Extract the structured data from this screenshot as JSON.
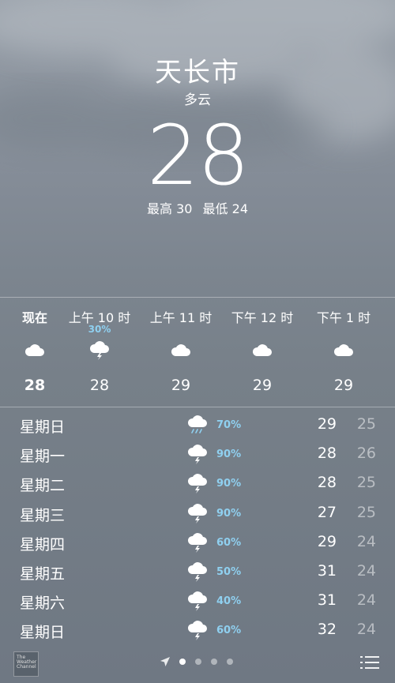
{
  "location": {
    "city": "天长市",
    "condition": "多云",
    "temperature": "28",
    "high": "最高 30",
    "low": "最低 24"
  },
  "hourly": [
    {
      "time": "现在",
      "pop": "",
      "icon": "cloud-icon",
      "temp": "28"
    },
    {
      "time": "上午 10 时",
      "pop": "30%",
      "icon": "thunderstorm-icon",
      "temp": "28"
    },
    {
      "time": "上午 11 时",
      "pop": "",
      "icon": "cloud-icon",
      "temp": "29"
    },
    {
      "time": "下午 12 时",
      "pop": "",
      "icon": "cloud-icon",
      "temp": "29"
    },
    {
      "time": "下午 1 时",
      "pop": "",
      "icon": "cloud-icon",
      "temp": "29"
    }
  ],
  "daily": [
    {
      "day": "星期日",
      "icon": "rain-icon",
      "pop": "70%",
      "high": "29",
      "low": "25"
    },
    {
      "day": "星期一",
      "icon": "thunderstorm-icon",
      "pop": "90%",
      "high": "28",
      "low": "26"
    },
    {
      "day": "星期二",
      "icon": "thunderstorm-icon",
      "pop": "90%",
      "high": "28",
      "low": "25"
    },
    {
      "day": "星期三",
      "icon": "thunderstorm-icon",
      "pop": "90%",
      "high": "27",
      "low": "25"
    },
    {
      "day": "星期四",
      "icon": "thunderstorm-icon",
      "pop": "60%",
      "high": "29",
      "low": "24"
    },
    {
      "day": "星期五",
      "icon": "thunderstorm-icon",
      "pop": "50%",
      "high": "31",
      "low": "24"
    },
    {
      "day": "星期六",
      "icon": "thunderstorm-icon",
      "pop": "40%",
      "high": "31",
      "low": "24"
    },
    {
      "day": "星期日",
      "icon": "thunderstorm-icon",
      "pop": "60%",
      "high": "32",
      "low": "24"
    }
  ],
  "footer": {
    "logo_lines": [
      "The",
      "Weather",
      "Channel"
    ],
    "page_count": 4,
    "active_page": 0,
    "icons": {
      "location": "location-arrow-icon",
      "menu": "list-menu-icon"
    }
  },
  "colors": {
    "precip": "#8fd0f0"
  }
}
